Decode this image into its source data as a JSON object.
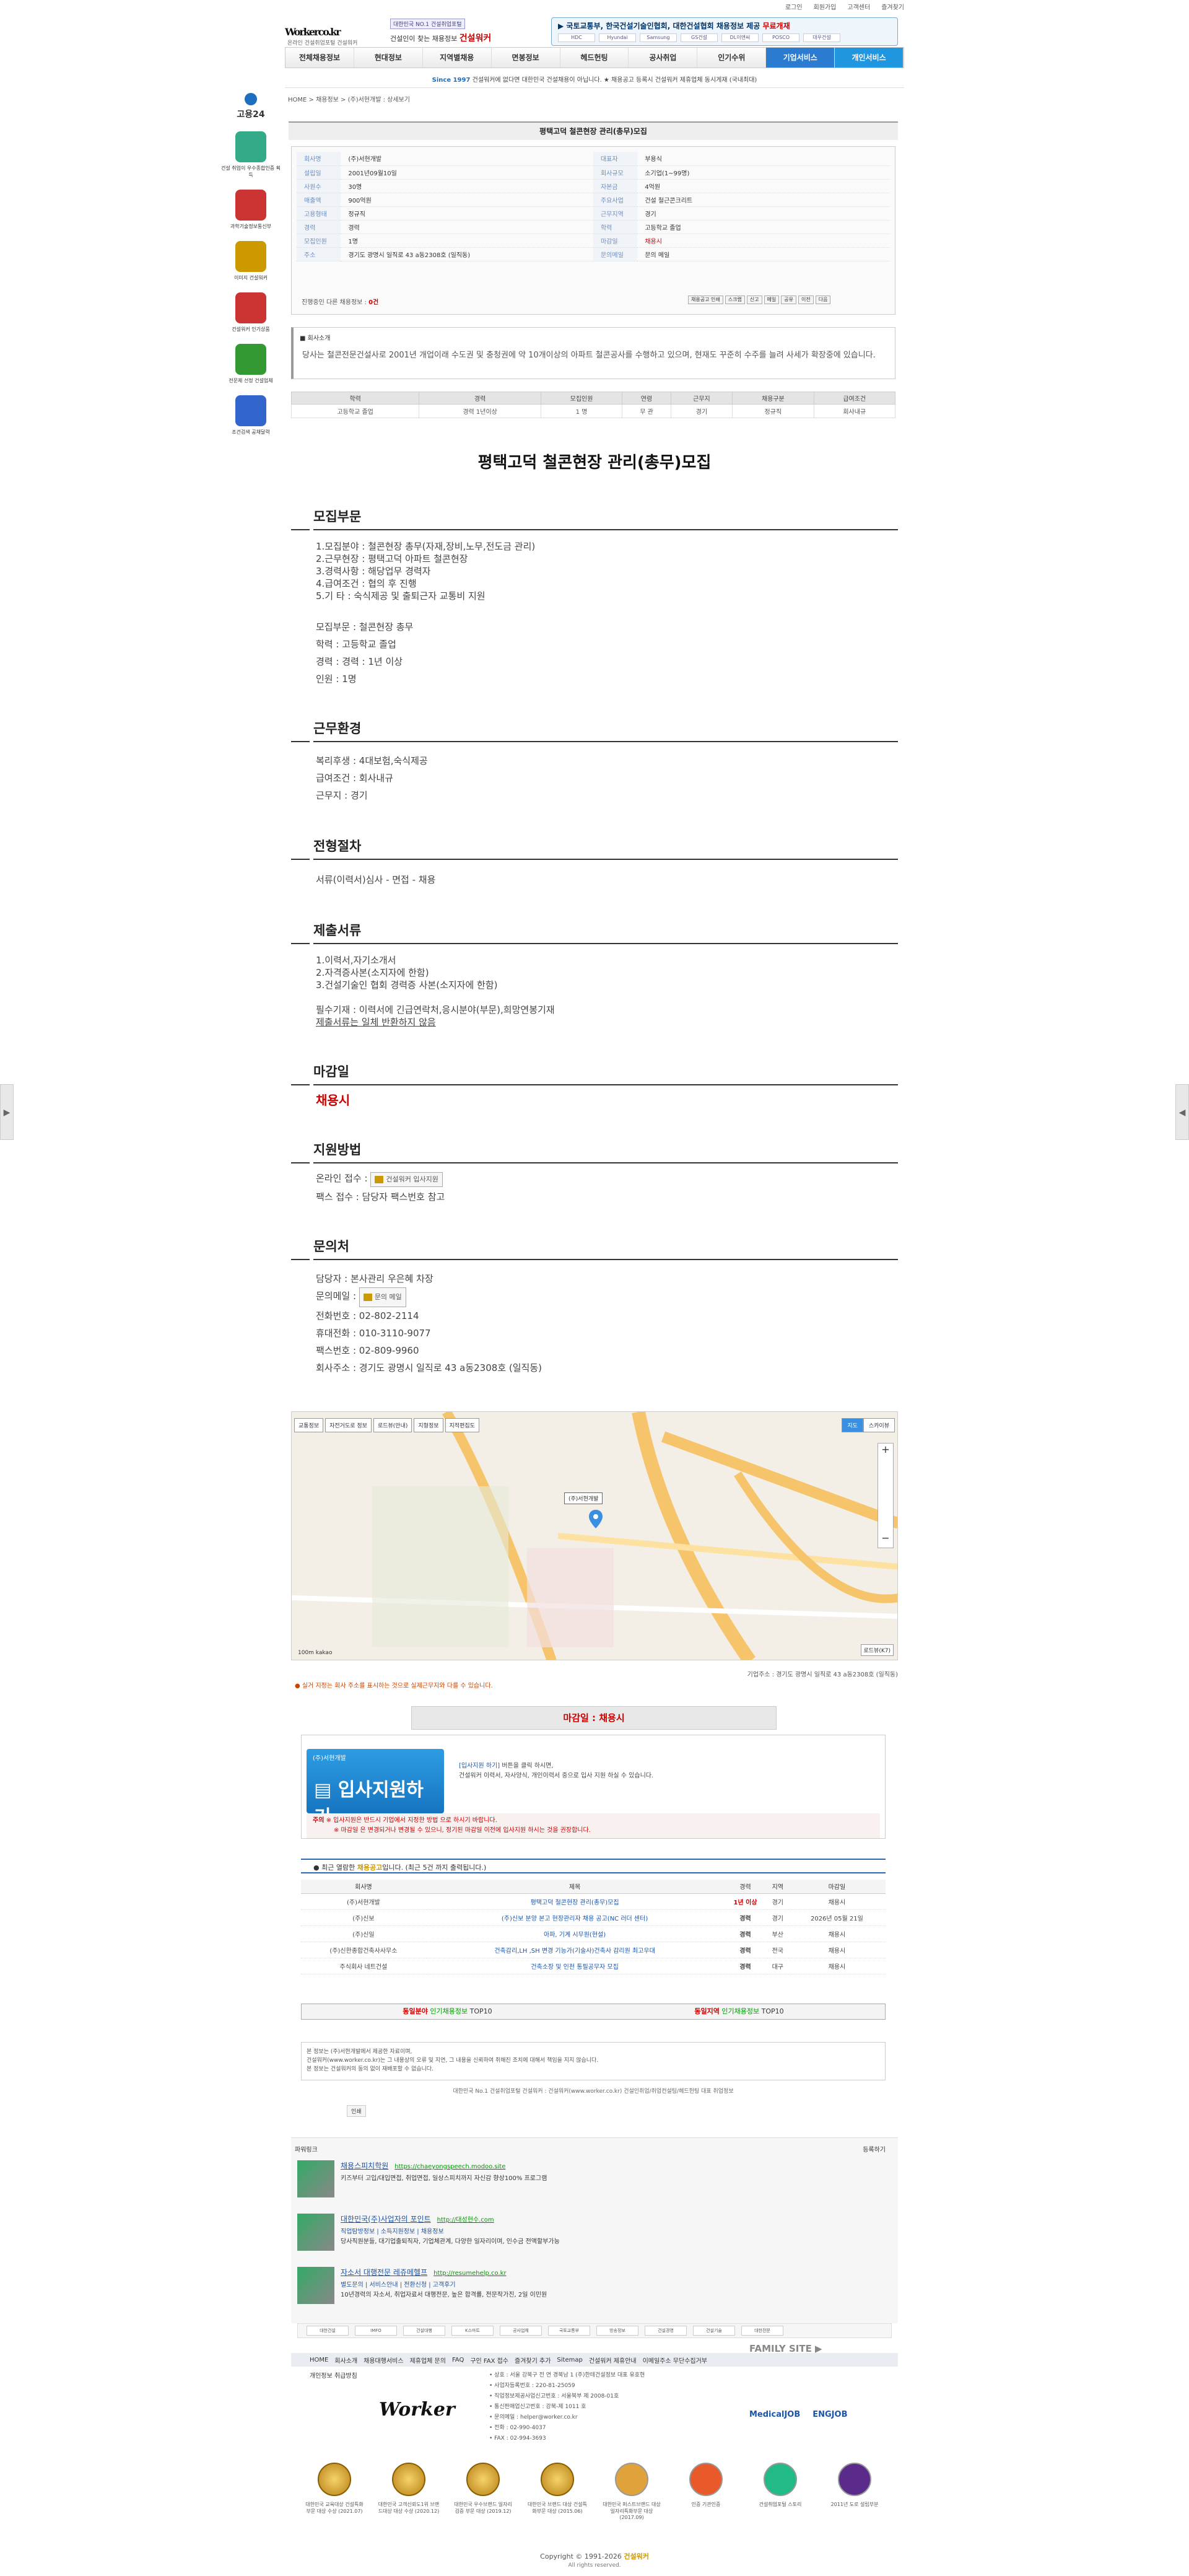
{
  "topnav": [
    "로그인",
    "회원가입",
    "고객센터",
    "즐겨찾기"
  ],
  "logo": {
    "name": "Worker",
    "domain": "co.kr",
    "tagline": "온라인 건설취업포털 건설워커"
  },
  "header": {
    "badge": "대한민국 NO.1 건설취업포털",
    "slogan_prefix": "건설인이 찾는 채용정보",
    "slogan_brand": "건설워커",
    "ticker_text": "국토교통부, 한국건설기술인협회, 대한건설협회 채용정보 제공",
    "ticker_highlight": "무료개재",
    "ticker_logos": [
      "HDC",
      "Hyundai",
      "Samsung",
      "GS건설",
      "DL이앤씨",
      "POSCO",
      "대우건설"
    ]
  },
  "mainnav": [
    "전체채용정보",
    "현대정보",
    "지역별채용",
    "면봉정보",
    "헤드헌팅",
    "공사취업",
    "인기수위",
    "기업서비스",
    "개인서비스"
  ],
  "notice": {
    "prefix": "Since 1997",
    "text": "건설워커에 없다면 대한민국 건설채용이 아닙니다. ★ 채용공고 등록시 건설워커 제휴업체 동시게재 (국내최대)"
  },
  "breadcrumb": "HOME > 채용정보 > (주)서현개발 : 상세보기",
  "sidebar": [
    {
      "label": "고용24",
      "icon": "employ-icon"
    },
    {
      "label": "건설 취업이 우수종합인증 획득",
      "icon": "cert-icon"
    },
    {
      "label": "과학기술정보통신부",
      "icon": "gov-icon"
    },
    {
      "label": "이미지 건설워커",
      "icon": "trophy-icon"
    },
    {
      "label": "건설워커 인기상품",
      "icon": "award-icon"
    },
    {
      "label": "전문제 선정 건설업체",
      "icon": "medal-icon"
    },
    {
      "label": "조건검색 공채달력",
      "icon": "calendar-icon"
    }
  ],
  "job": {
    "title": "평택고덕 철콘현장 관리(총무)모집",
    "fields": [
      [
        "회사명",
        "(주)서현개발",
        "대표자",
        "부용식"
      ],
      [
        "설립일",
        "2001년09월10일",
        "회사규모",
        "소기업(1~99명)"
      ],
      [
        "사원수",
        "30명",
        "자본금",
        "4억원"
      ],
      [
        "매출액",
        "900억원",
        "주요사업",
        "건설 철근콘크리트"
      ],
      [
        "고용형태",
        "정규직",
        "근무지역",
        "경기"
      ],
      [
        "경력",
        "경력",
        "학력",
        "고등학교 졸업"
      ],
      [
        "모집인원",
        "1명",
        "마감일",
        "채용시"
      ],
      [
        "주소",
        "경기도 광명시 일직로 43 a동2308호 (일직동)",
        "문의메일",
        "문의 메일"
      ]
    ],
    "progress_label": "진행중인 다른 채용정보",
    "progress_count": "0건",
    "small_buttons": [
      "채용공고 인쇄",
      "스크랩",
      "신고",
      "메일",
      "공유",
      "이전",
      "다음"
    ],
    "intro_heading": "회사소개",
    "intro_text": "당사는 철콘전문건설사로 2001년 개업이래 수도권 및 충청권에 약 10개이상의 아파트 철콘공사를 수행하고 있으며, 현재도 꾸준히 수주를 늘려 사세가 확장중에 있습니다.",
    "summary_headers": [
      "학력",
      "경력",
      "모집인원",
      "연령",
      "근무지",
      "채용구분",
      "급여조건"
    ],
    "summary_values": [
      "고등학교 졸업",
      "경력 1년이상",
      "1 명",
      "무 관",
      "경기",
      "정규직",
      "회사내규"
    ]
  },
  "detail": {
    "big_title": "평택고덕 철콘현장 관리(총무)모집",
    "sections": {
      "recruit": {
        "heading": "모집부문",
        "lines": [
          "1.모집분야 : 철콘현장 총무(자재,장비,노무,전도금 관리)",
          "2.근무현장 : 평택고덕 아파트 철콘현장",
          "3.경력사항 : 해당업무 경력자",
          "4.급여조건 : 협의 후 진행",
          "5.기   타 : 숙식제공 및 출퇴근자 교통비 지원"
        ],
        "lines2": [
          "모집부문 : 철콘현장 총무",
          "학력 : 고등학교 졸업",
          "경력 : 경력 : 1년 이상",
          "인원 : 1명"
        ]
      },
      "env": {
        "heading": "근무환경",
        "lines": [
          "복리후생 : 4대보험,숙식제공",
          "급여조건 : 회사내규",
          "근무지 : 경기"
        ]
      },
      "process": {
        "heading": "전형절차",
        "lines": [
          "서류(이력서)심사 - 면접 - 채용"
        ]
      },
      "docs": {
        "heading": "제출서류",
        "lines": [
          "1.이력서,자기소개서",
          "2.자격증사본(소지자에 한함)",
          "3.건설기술인 협회 경력증 사본(소지자에 한함)"
        ],
        "required": "필수기재 : 이력서에 긴급연락처,응시분야(부문),희망연봉기재",
        "link": "제출서류는 일체 반환하지 않음"
      },
      "deadline": {
        "heading": "마감일",
        "value": "채용시"
      },
      "apply": {
        "heading": "지원방법",
        "online_label": "온라인 접수 :",
        "online_btn": "건설워커 입사지원",
        "fax": "팩스 접수 : 담당자 팩스번호 참고"
      },
      "contact": {
        "heading": "문의처",
        "manager": "담당자 : 본사관리 우은혜 차장",
        "email_label": "문의메일 :",
        "email_btn": "문의 메일",
        "phone": "전화번호 : 02-802-2114",
        "mobile": "휴대전화 : 010-3110-9077",
        "fax": "팩스번호 : 02-809-9960",
        "address": "회사주소 : 경기도 광명시 일직로 43 a동2308호 (일직동)"
      }
    }
  },
  "map": {
    "tabs": [
      "교통정보",
      "자전거도로 정보",
      "로드뷰(안내)",
      "지형정보",
      "지적편집도"
    ],
    "types": [
      "지도",
      "스카이뷰"
    ],
    "marker_label": "(주)서현개발",
    "scale": "100m kakao",
    "roadview": "로드뷰(K7)",
    "location": "기업주소 : 경기도 광명시 일직로 43 a동2308호 (일직동)",
    "warning": "실거 지정는 회사 주소를 표시하는 것으로 실제근무지와 다를 수 있습니다."
  },
  "apply_box": {
    "deadline_label": "마감일 :",
    "deadline_value": "채용시",
    "company": "(주)서현개발",
    "button": "입사지원하기",
    "text1_a": "[입사지원 하기]",
    "text1_b": " 버튼을 클릭 하시면,",
    "text2": "건설워커 이력서, 자사양식, 개인이력서 중으로 입사 지원 하실 수 있습니다.",
    "note_label": "주의",
    "note1": "※ 입사지원은 반드시 기업에서 지정한 방법 으로 하시기 바랍니다.",
    "note2": "※ 마감일 은 변경되거나 변경될 수 있으니, 정기된 마감일 이전에 입사지원 하시는 것을 권장합니다."
  },
  "recent": {
    "title_a": "최근 열람한",
    "title_b": "채용공고",
    "title_c": "입니다. (최근 5건 까지 출력됩니다.)",
    "headers": [
      "회사명",
      "제목",
      "경력",
      "지역",
      "마감일"
    ],
    "rows": [
      [
        "(주)서현개발",
        "평택고덕 철콘현장 관리(총무)모집",
        "1년 이상",
        "경기",
        "채용시"
      ],
      [
        "(주)신보",
        "(주)신보 분양 본고 현장관리자 채용 공고(NC 러더 센터)",
        "경력",
        "경기",
        "2026년 05월 21일"
      ],
      [
        "(주)신일",
        "아파, 기계 시무원(현설)",
        "경력",
        "부산",
        "채용시"
      ],
      [
        "(주)신한종합건축사사무소",
        "건축감리,LH ,SH 변경 기능가(기술사)건축사 감리원 최고우대",
        "경력",
        "전국",
        "채용시"
      ],
      [
        "주식회사 네트건설",
        "건축소장 및 인천 통필공무자 모집",
        "경력",
        "대구",
        "채용시"
      ]
    ]
  },
  "top10": [
    {
      "a": "동일분야",
      "b": " 인기채용정보 ",
      "c": "TOP10"
    },
    {
      "a": "동일지역",
      "b": " 인기채용정보 ",
      "c": "TOP10"
    }
  ],
  "disclaimer": [
    "본 정보는 (주)서현개발에서 제공한 자료이며,",
    "건설워커(www.worker.co.kr)는 그 내용상의 오류 및 지연, 그 내용을 신뢰하여 취해진 조치에 대해서 책임을 지지 않습니다.",
    "본 정보는 건설워커의 동의 없이 재배포할 수 없습니다."
  ],
  "copyright_note": "대한민국 No.1 건설취업포털 건설워커 : 건설워커(www.worker.co.kr) 건설인취업/취업컨설팅/헤드헌팅 대표 취업정보",
  "print_btn": "인쇄",
  "partners": {
    "heading": "파워링크",
    "register": "등록하기",
    "items": [
      {
        "title": "채용스피치학원",
        "url": "https://chaeyongspeech.modoo.site",
        "sub": "",
        "desc": "키즈부터 고입/대입면접, 취업면접, 일상스피치까지 자신감 향상100% 프로그램"
      },
      {
        "title": "대한민국(주)사업자의 포인트",
        "url": "http://대성현수.com",
        "sub": "직업탐방정보 | 소득지원정보 | 채용정보",
        "desc": "당사직원분들, 대기업출퇴직자, 기업체관계, 다양한 일자리이며, 인수금 전액할부가능"
      },
      {
        "title": "자소서 대행전문 레쥬메헬프",
        "url": "http://resumehelp.co.kr",
        "sub": "별도문의 | 서비스안내 | 전환신청 | 고객후기",
        "desc": "10년경력의 자소서, 취업자료서 대행전문, 높은 합격률, 전문작가진, 2일 이민원"
      }
    ]
  },
  "banners": [
    "대한건설",
    "IMFO",
    "건설대행",
    "K스마트",
    "공사업체",
    "국토교통부",
    "방송정보",
    "건설경영",
    "건설기술",
    "대한전문"
  ],
  "footer": {
    "nav": [
      "HOME",
      "회사소개",
      "채용대행서비스",
      "제휴업체 문의",
      "FAQ",
      "구인 FAX 접수",
      "즐겨찾기 추가",
      "Sitemap",
      "건설워커 제휴안내",
      "이메일주소 무단수집거부"
    ],
    "privacy": "개인정보 취급방침",
    "company": [
      "• 상호 : 서울 강북구 전 연 경북남 1 (주)한테건설정보 대표 유호현",
      "• 사업자등록번호 : 220-81-25059",
      "• 직업정보제공사업신고번호 : 서울북부 제 2008-01호",
      "• 통신판매업신고번호 : 강북-제 1011 호",
      "• 문의메일 : helper@worker.co.kr",
      "• 전화 : 02-990-4037",
      "• FAX : 02-994-3693"
    ],
    "logo": "Worker",
    "family": "FAMILY SITE",
    "family_logos": [
      "MedicalJOB",
      "ENGJOB"
    ],
    "certs": [
      "대한민국 교육대상 건설특화부문 대상 수상 (2021.07)",
      "대한민국 고객신뢰도1위 브랜드대상 대상 수상 (2020.12)",
      "대한민국 우수브랜드 일자리 검증 부문 대상 (2019.12)",
      "대한민국 브랜드 대상 건설특화부문 대상 (2015.06)",
      "대한민국 퍼스트브랜드 대상 일자리특화부문 대상 (2017.09)",
      "인증 기관인증",
      "건설취업포털 스토리",
      "2011년 도로 설립부분"
    ]
  },
  "copyright": {
    "prefix": "Copyright © 1991-2026",
    "brand": "건설워커",
    "suffix": "All rights reserved."
  },
  "colors": {
    "brand_blue": "#1f96df",
    "accent_red": "#cc0000"
  }
}
